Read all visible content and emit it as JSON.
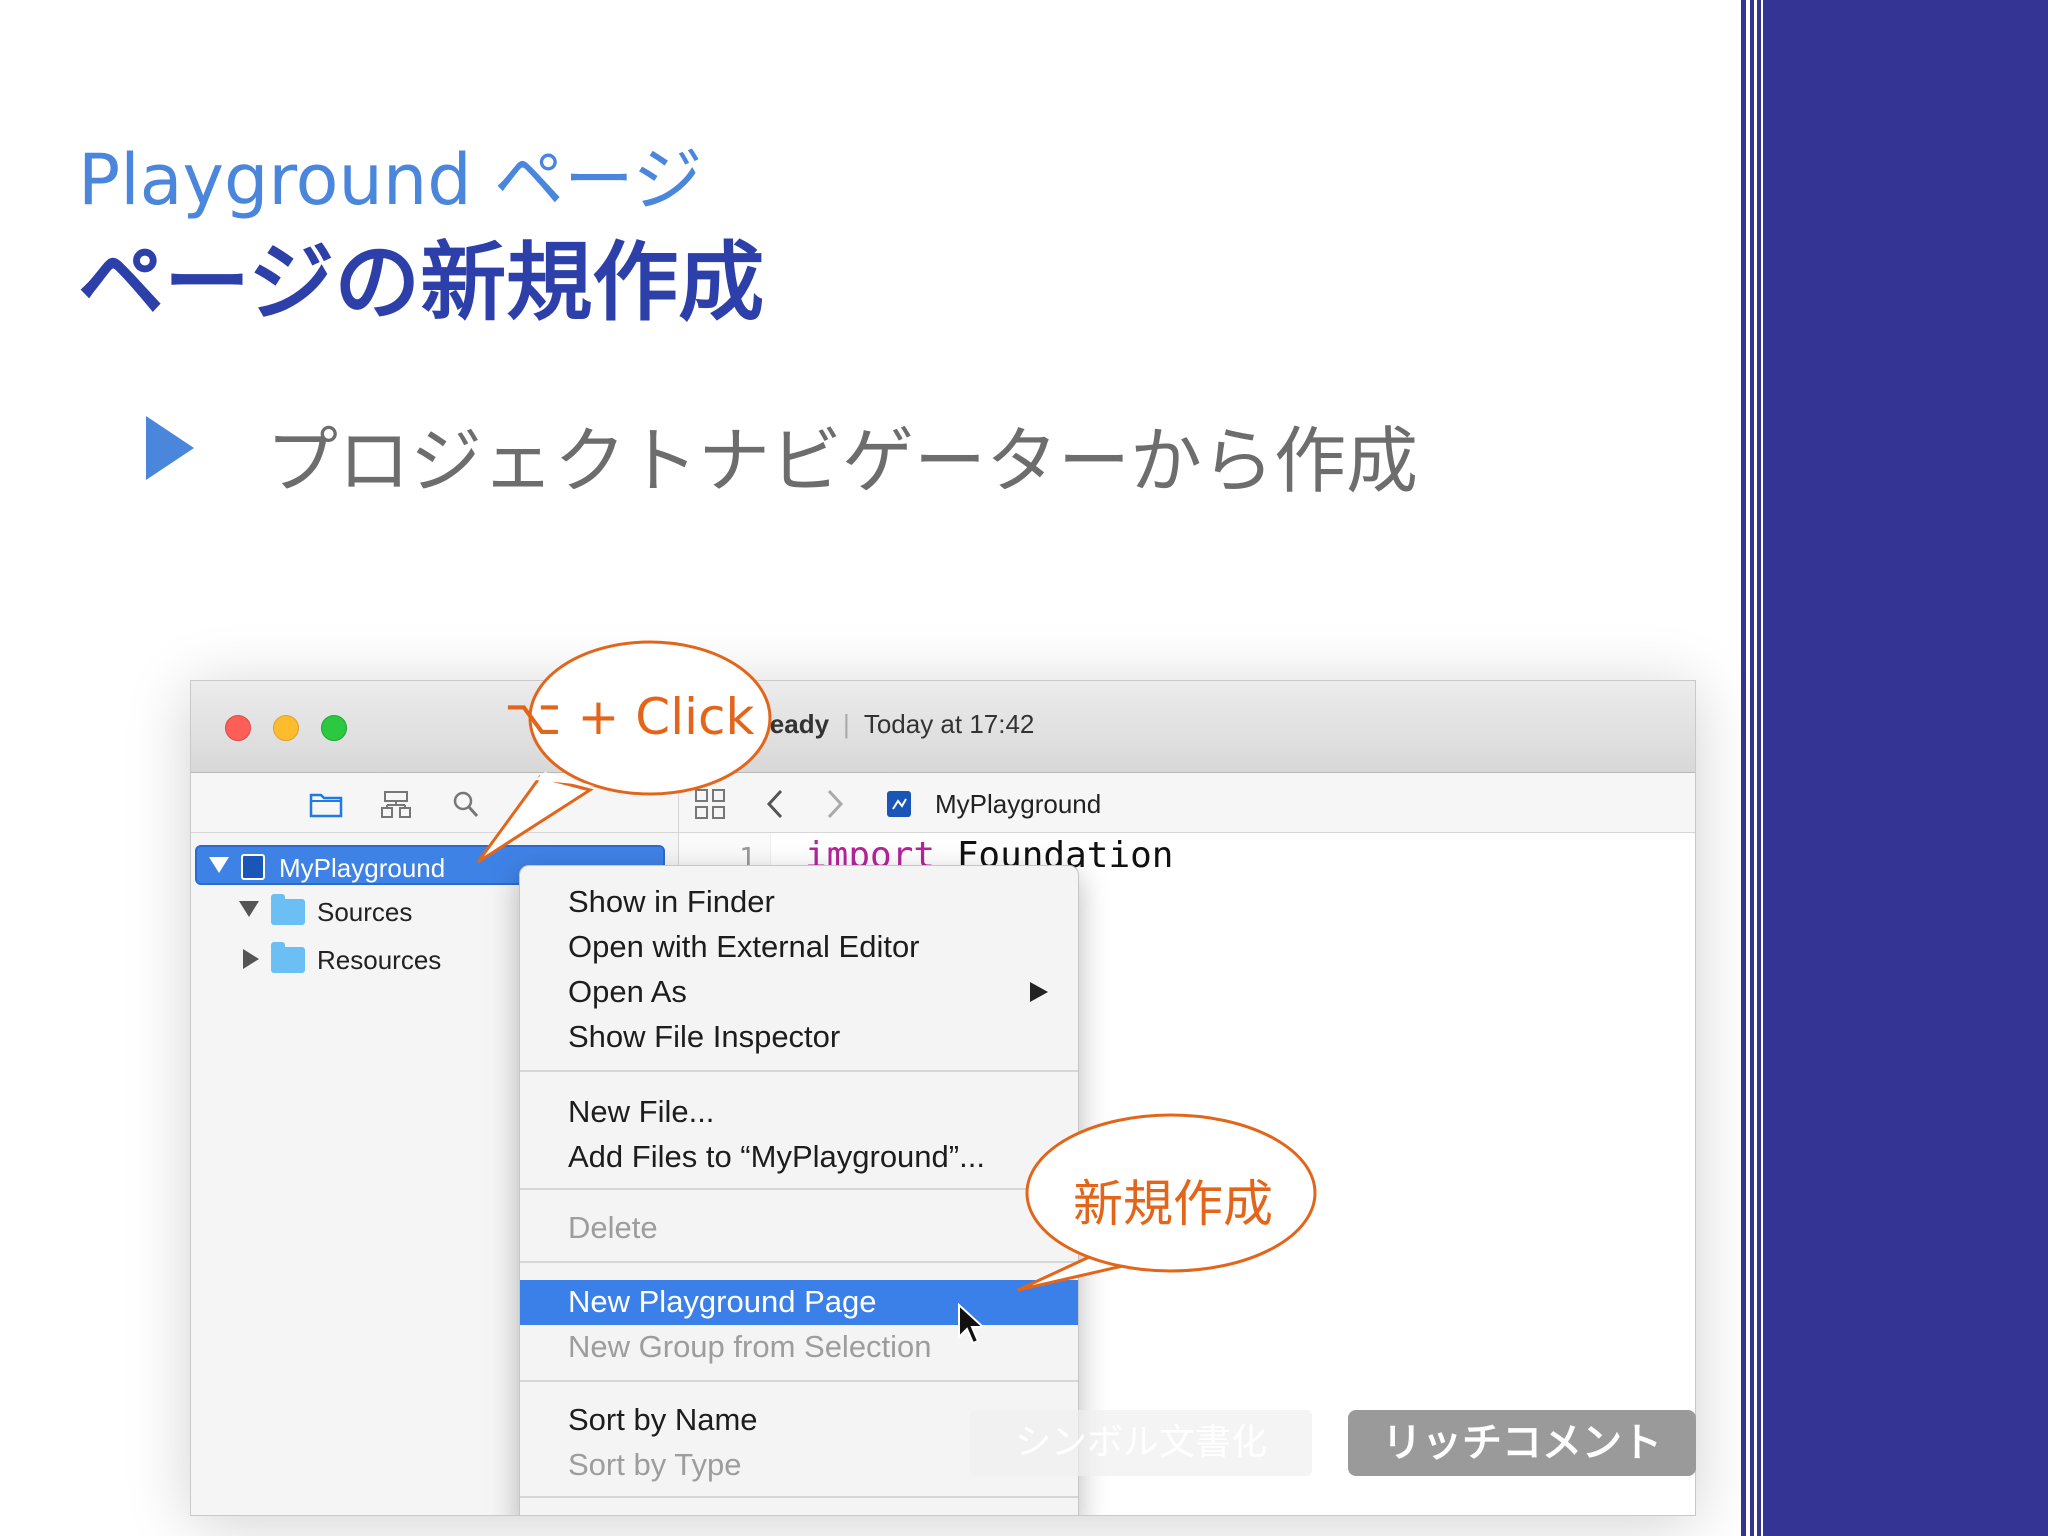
{
  "slide": {
    "subtitle": "Playground ページ",
    "title": "ページの新規作成",
    "bullet": "プロジェクトナビゲーターから作成"
  },
  "colors": {
    "accent_blue": "#4a86dc",
    "title_blue": "#2d3fa8",
    "band": "#343494",
    "callout_orange": "#e2651a",
    "menu_highlight": "#3b7fe8"
  },
  "xcode": {
    "activity_status": "Ready",
    "activity_separator": "|",
    "activity_time": "Today at 17:42",
    "navigator_icons": [
      "folder-icon",
      "hierarchy-icon",
      "search-icon",
      "warning-icon"
    ],
    "jump_bar": {
      "title": "MyPlayground",
      "icons": [
        "grid-icon",
        "back-arrow-icon",
        "forward-arrow-icon",
        "playground-file-icon"
      ]
    },
    "tree": [
      {
        "label": "MyPlayground",
        "selected": true,
        "expanded": true
      },
      {
        "label": "Sources",
        "expanded": true
      },
      {
        "label": "Resources",
        "expanded": false
      }
    ],
    "code": {
      "line_number": "1",
      "keyword": "import",
      "rest": " Foundation"
    }
  },
  "context_menu": {
    "items": [
      {
        "label": "Show in Finder"
      },
      {
        "label": "Open with External Editor"
      },
      {
        "label": "Open As",
        "submenu": true
      },
      {
        "label": "Show File Inspector"
      },
      {
        "label": "New File..."
      },
      {
        "label": "Add Files to “MyPlayground”..."
      },
      {
        "label": "Delete",
        "disabled": true
      },
      {
        "label": "New Playground Page",
        "highlighted": true
      },
      {
        "label": "New Group from Selection",
        "disabled": true
      },
      {
        "label": "Sort by Name"
      },
      {
        "label": "Sort by Type",
        "disabled": true
      }
    ]
  },
  "callouts": {
    "option_click": "⌥ + Click",
    "new_create": "新規作成"
  },
  "overlay_buttons": {
    "symbol_doc": "シンボル文書化",
    "rich_comment": "リッチコメント"
  }
}
